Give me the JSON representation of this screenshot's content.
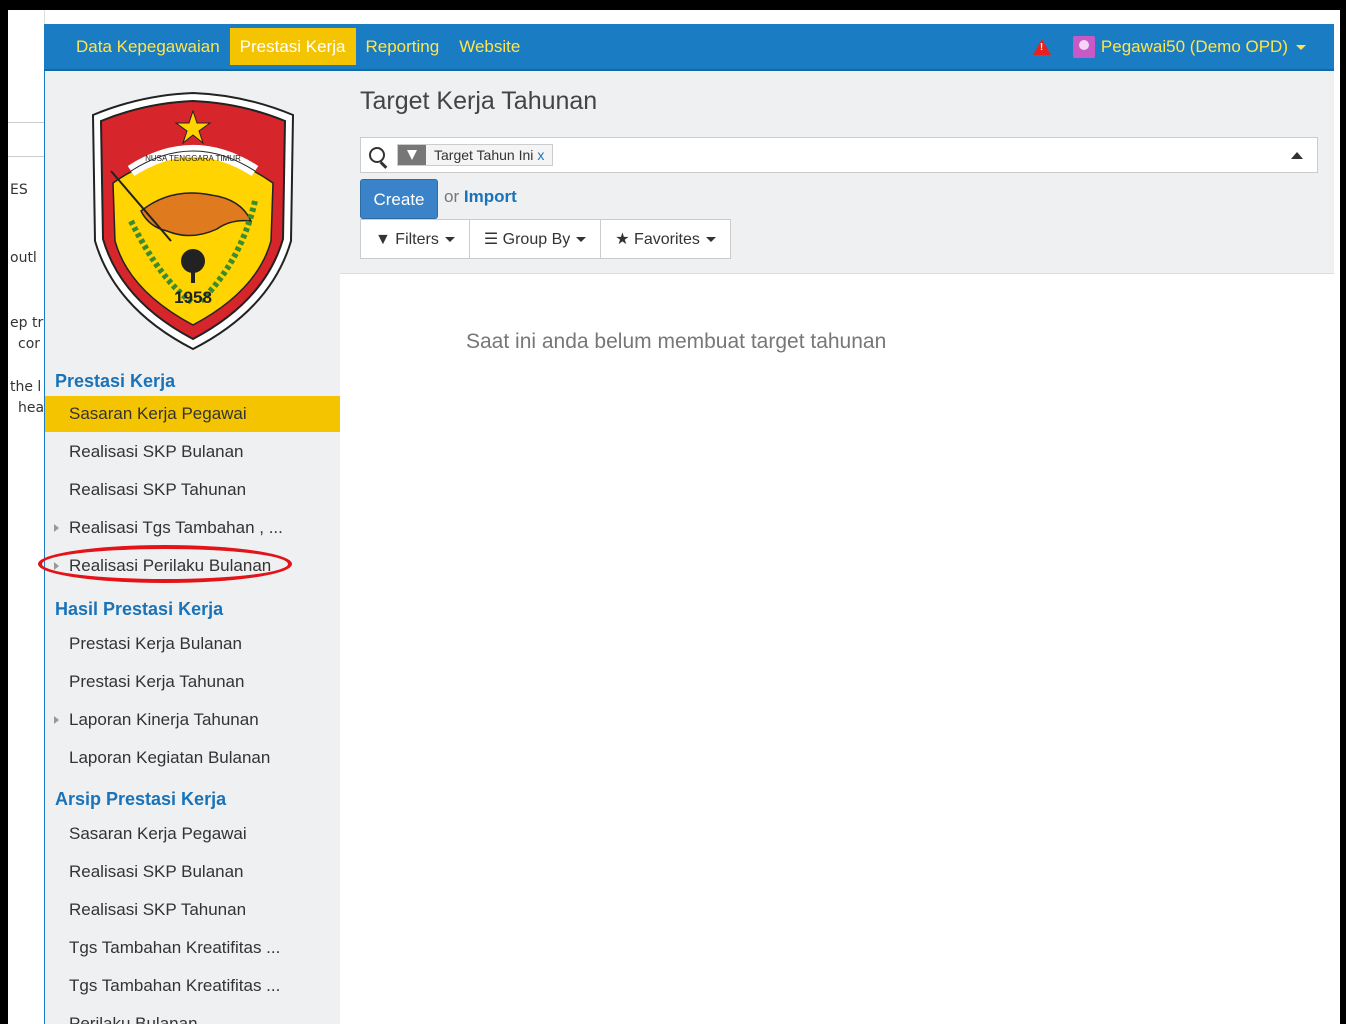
{
  "background_fragments": [
    "ES",
    "outl",
    "ep tr",
    "cor",
    "the l",
    "hea"
  ],
  "topbar": {
    "menu": [
      "Data Kepegawaian",
      "Prestasi Kerja",
      "Reporting",
      "Website"
    ],
    "active_menu": "Prestasi Kerja",
    "user": "Pegawai50 (Demo OPD)",
    "colors": {
      "bar": "#1a7dc4",
      "menu_text": "#ffe44d",
      "active_bg": "#f5c400",
      "alert": "#e8201e"
    }
  },
  "logo": {
    "banner_text": "NUSA TENGGARA TIMUR",
    "year": "1958"
  },
  "sidebar": {
    "section_1": {
      "title": "Prestasi Kerja",
      "items": [
        "Sasaran Kerja Pegawai",
        "Realisasi SKP Bulanan",
        "Realisasi SKP Tahunan",
        "Realisasi Tgs Tambahan , ...",
        "Realisasi Perilaku Bulanan"
      ]
    },
    "section_2": {
      "title": "Hasil Prestasi Kerja",
      "items": [
        "Prestasi Kerja Bulanan",
        "Prestasi Kerja Tahunan",
        "Laporan Kinerja Tahunan",
        "Laporan Kegiatan Bulanan"
      ]
    },
    "section_3": {
      "title": "Arsip Prestasi Kerja",
      "items": [
        "Sasaran Kerja Pegawai",
        "Realisasi SKP Bulanan",
        "Realisasi SKP Tahunan",
        "Tgs Tambahan Kreatifitas ...",
        "Tgs Tambahan Kreatifitas ...",
        "Perilaku Bulanan"
      ]
    }
  },
  "main": {
    "title": "Target Kerja Tahunan",
    "search": {
      "facet_label": "Target Tahun Ini",
      "facet_remove": "x"
    },
    "create_label": "Create",
    "or_label": "or",
    "import_label": "Import",
    "filters_label": "Filters",
    "groupby_label": "Group By",
    "favorites_label": "Favorites",
    "empty_message": "Saat ini anda belum membuat target tahunan"
  }
}
